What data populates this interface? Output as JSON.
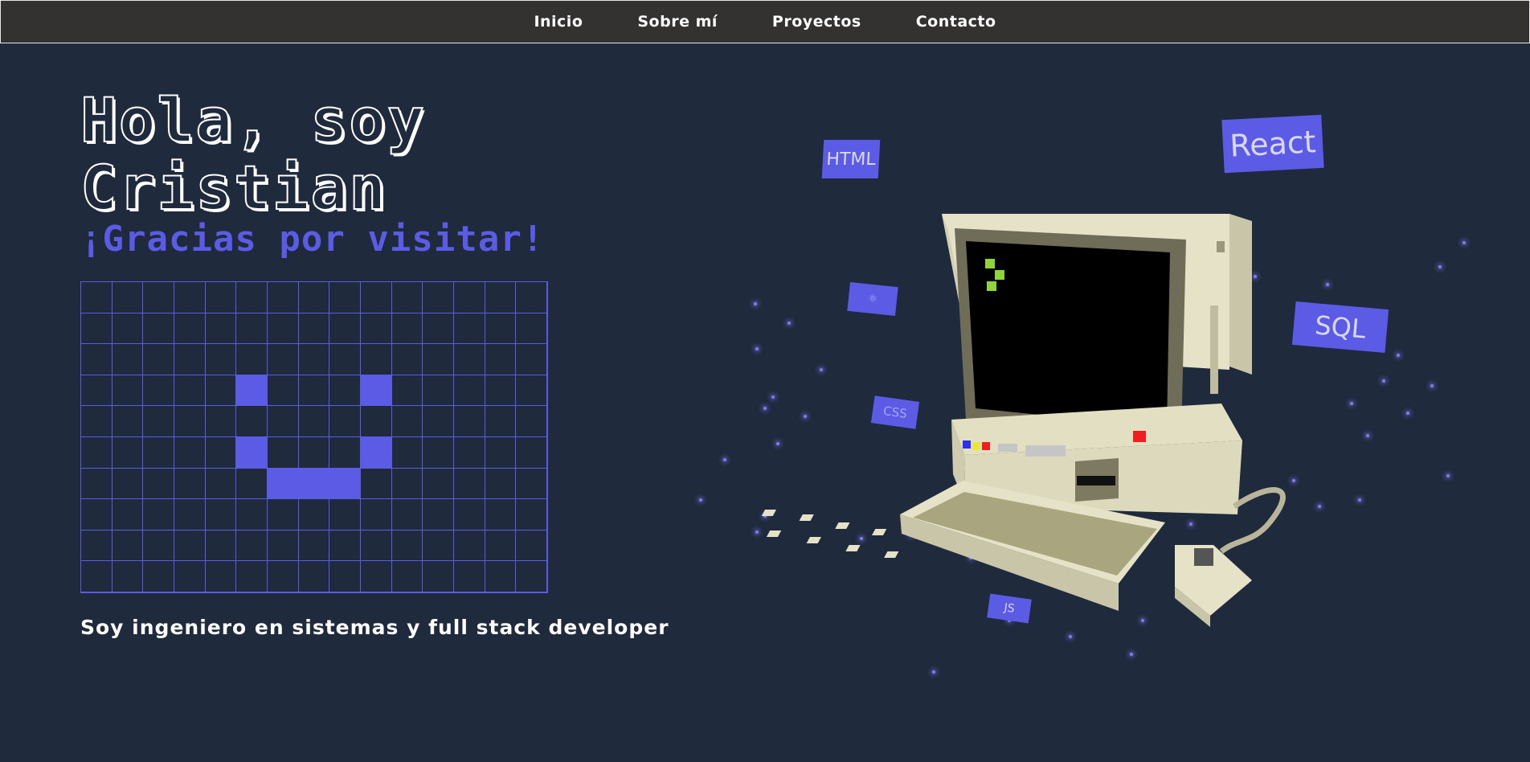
{
  "nav": {
    "items": [
      {
        "label": "Inicio"
      },
      {
        "label": "Sobre mí"
      },
      {
        "label": "Proyectos"
      },
      {
        "label": "Contacto"
      }
    ]
  },
  "hero": {
    "title_line1": "Hola, soy",
    "title_line2": "Cristian",
    "subtitle": "¡Gracias por visitar!",
    "tagline": "Soy ingeniero en sistemas y full stack developer"
  },
  "tech_tags": [
    "HTML",
    "React",
    "SQL",
    "CSS",
    "JS"
  ],
  "colors": {
    "background": "#1f2a3c",
    "nav_background": "#333231",
    "accent": "#5b5be6",
    "computer_body": "#e6e2c8"
  }
}
